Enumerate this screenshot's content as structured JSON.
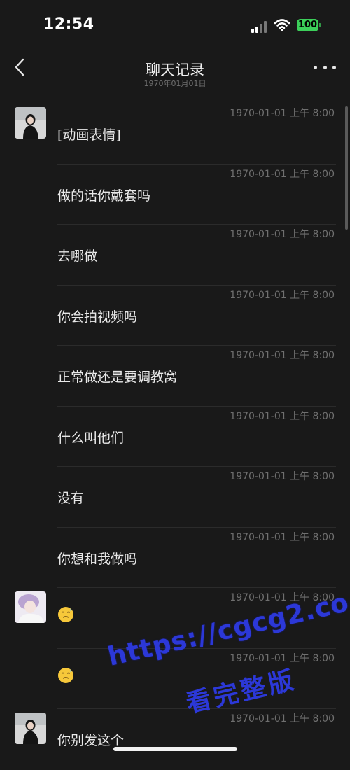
{
  "status_bar": {
    "time": "12:54",
    "battery": "100"
  },
  "nav": {
    "title": "聊天记录",
    "subtitle": "1970年01月01日"
  },
  "messages": [
    {
      "sender": "female-avatar",
      "timestamp": "1970-01-01 上午 8:00",
      "text": "[动画表情]"
    },
    {
      "timestamp": "1970-01-01 上午 8:00",
      "text": "做的话你戴套吗"
    },
    {
      "timestamp": "1970-01-01 上午 8:00",
      "text": "去哪做"
    },
    {
      "timestamp": "1970-01-01 上午 8:00",
      "text": "你会拍视频吗"
    },
    {
      "timestamp": "1970-01-01 上午 8:00",
      "text": "正常做还是要调教窝"
    },
    {
      "timestamp": "1970-01-01 上午 8:00",
      "text": "什么叫他们"
    },
    {
      "timestamp": "1970-01-01 上午 8:00",
      "text": "没有"
    },
    {
      "timestamp": "1970-01-01 上午 8:00",
      "text": "你想和我做吗"
    },
    {
      "sender": "male-avatar",
      "timestamp": "1970-01-01 上午 8:00",
      "emoji": "sweat-smile-emoji"
    },
    {
      "timestamp": "1970-01-01 上午 8:00",
      "emoji": "sweat-smile-emoji"
    },
    {
      "sender": "female-avatar",
      "timestamp": "1970-01-01 上午 8:00",
      "text": "你别发这个"
    }
  ],
  "watermark": {
    "url": "https://cgcg2.co",
    "text": "看完整版",
    "color": "#2c38d8"
  },
  "colors": {
    "background": "#191919",
    "text": "#e9e9e9",
    "timestamp": "#6f6f6f",
    "battery": "#3ccf5a"
  }
}
